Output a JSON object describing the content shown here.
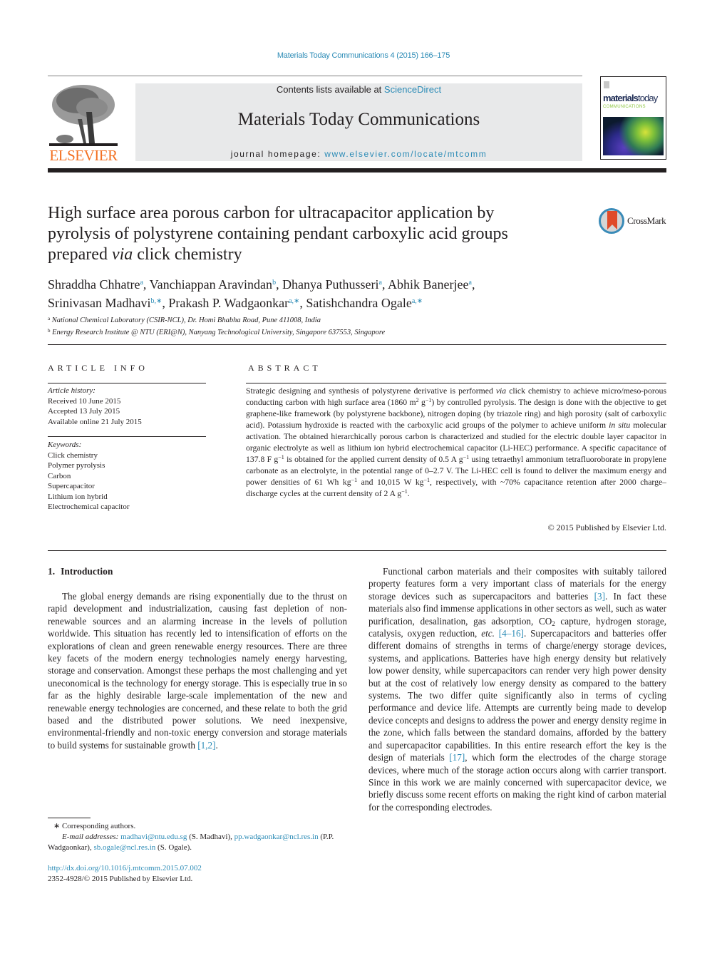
{
  "header": {
    "journal_ref": "Materials Today Communications 4 (2015) 166–175",
    "contents_prefix": "Contents lists available at ",
    "contents_link": "ScienceDirect",
    "journal_title": "Materials Today Communications",
    "homepage_prefix": "journal homepage: ",
    "homepage_link": "www.elsevier.com/locate/mtcomm",
    "publisher_logo_text": "ELSEVIER",
    "cover_brand_bold": "materials",
    "cover_brand_light": "today",
    "cover_sub": "COMMUNICATIONS",
    "crossmark_label": "CrossMark",
    "colors": {
      "link": "#2b8bb6",
      "elsevier_orange": "#f37021",
      "banner_bg": "#e8e9ea"
    }
  },
  "article": {
    "title_line1": "High surface area porous carbon for ultracapacitor application by",
    "title_line2": "pyrolysis of polystyrene containing pendant carboxylic acid groups",
    "title_line3_pre": "prepared ",
    "title_line3_it": "via",
    "title_line3_post": " click chemistry",
    "authors": [
      {
        "name": "Shraddha Chhatre",
        "aff": "a",
        "sep": ", "
      },
      {
        "name": "Vanchiappan Aravindan",
        "aff": "b",
        "sep": ", "
      },
      {
        "name": "Dhanya Puthusseri",
        "aff": "a",
        "sep": ", "
      },
      {
        "name": "Abhik Banerjee",
        "aff": "a",
        "sep": ","
      },
      {
        "name": "Srinivasan Madhavi",
        "aff": "b,∗",
        "sep": ", "
      },
      {
        "name": "Prakash P. Wadgaonkar",
        "aff": "a,∗",
        "sep": ", "
      },
      {
        "name": "Satishchandra Ogale",
        "aff": "a,∗",
        "sep": ""
      }
    ],
    "affiliations": [
      {
        "key": "a",
        "text": "National Chemical Laboratory (CSIR-NCL), Dr. Homi Bhabha Road, Pune 411008, India"
      },
      {
        "key": "b",
        "text": "Energy Research Institute @ NTU (ERI@N), Nanyang Technological University, Singapore 637553, Singapore"
      }
    ]
  },
  "article_info": {
    "heading": "ARTICLE INFO",
    "history_label": "Article history:",
    "history": [
      "Received 10 June 2015",
      "Accepted 13 July 2015",
      "Available online 21 July 2015"
    ],
    "keywords_label": "Keywords:",
    "keywords": [
      "Click chemistry",
      "Polymer pyrolysis",
      "Carbon",
      "Supercapacitor",
      "Lithium ion hybrid",
      "Electrochemical capacitor"
    ]
  },
  "abstract": {
    "heading": "ABSTRACT",
    "s1": "Strategic designing and synthesis of polystyrene derivative is performed ",
    "s1_it": "via",
    "s2": " click chemistry to achieve micro/meso-porous conducting carbon with high surface area (1860 m",
    "sup_2": "2",
    "s3": " g",
    "sup_m1": "−1",
    "s4": ") by controlled pyrolysis. The design is done with the objective to get graphene-like framework (by polystyrene backbone), nitrogen doping (by triazole ring) and high porosity (salt of carboxylic acid). Potassium hydroxide is reacted with the carboxylic acid groups of the polymer to achieve uniform ",
    "s4_it": "in situ",
    "s5": " molecular activation. The obtained hierarchically porous carbon is characterized and studied for the electric double layer capacitor in organic electrolyte as well as lithium ion hybrid electrochemical capacitor (Li-HEC) performance. A specific capacitance of 137.8 F g",
    "s6": " is obtained for the applied current density of 0.5 A g",
    "s7": " using tetraethyl ammonium tetrafluoroborate in propylene carbonate as an electrolyte, in the potential range of 0–2.7 V. The Li-HEC cell is found to deliver the maximum energy and power densities of 61 Wh kg",
    "s8": " and 10,015 W kg",
    "s9": ", respectively, with ~70% capacitance retention after 2000 charge–discharge cycles at the current density of 2 A g",
    "s10": ".",
    "copyright": "© 2015 Published by Elsevier Ltd."
  },
  "body": {
    "section_num": "1.",
    "section_title": "Introduction",
    "left_p1": "The global energy demands are rising exponentially due to the thrust on rapid development and industrialization, causing fast depletion of non-renewable sources and an alarming increase in the levels of pollution worldwide. This situation has recently led to intensification of efforts on the explorations of clean and green renewable energy resources. There are three key facets of the modern energy technologies namely energy harvesting, storage and conservation. Amongst these perhaps the most challenging and yet uneconomical is the technology for energy storage. This is especially true in so far as the highly desirable large-scale implementation of the new and renewable energy technologies are concerned, and these relate to both the grid based and the distributed power solutions. We need inexpensive, environmental-friendly and non-toxic energy conversion and storage materials to build systems for sustainable growth ",
    "left_ref": "[1,2]",
    "left_end": ".",
    "right_a": "Functional carbon materials and their composites with suitably tailored property features form a very important class of materials for the energy storage devices such as supercapacitors and batteries ",
    "right_ref1": "[3]",
    "right_b": ". In fact these materials also find immense applications in other sectors as well, such as water purification, desalination, gas adsorption, CO",
    "right_sub": "2",
    "right_c": " capture, hydrogen storage, catalysis, oxygen reduction, ",
    "right_etc": "etc.",
    "right_sp": " ",
    "right_ref2": "[4–16]",
    "right_d": ". Supercapacitors and batteries offer different domains of strengths in terms of charge/energy storage devices, systems, and applications. Batteries have high energy density but relatively low power density, while supercapacitors can render very high power density but at the cost of relatively low energy density as compared to the battery systems. The two differ quite significantly also in terms of cycling performance and device life. Attempts are currently being made to develop device concepts and designs to address the power and energy density regime in the zone, which falls between the standard domains, afforded by the battery and supercapacitor capabilities. In this entire research effort the key is the design of materials ",
    "right_ref3": "[17]",
    "right_e": ", which form the electrodes of the charge storage devices, where much of the storage action occurs along with carrier transport. Since in this work we are mainly concerned with supercapacitor device, we briefly discuss some recent efforts on making the right kind of carbon material for the corresponding electrodes."
  },
  "footnote": {
    "star": "∗ Corresponding authors.",
    "email_label": "E-mail addresses:",
    "email1": "madhavi@ntu.edu.sg",
    "email1_owner": " (S. Madhavi), ",
    "email2": "pp.wadgaonkar@ncl.res.in",
    "email2_owner": " (P.P. Wadgaonkar), ",
    "email3": "sb.ogale@ncl.res.in",
    "email3_owner": " (S. Ogale).",
    "doi": "http://dx.doi.org/10.1016/j.mtcomm.2015.07.002",
    "issn_line": "2352-4928/© 2015 Published by Elsevier Ltd."
  }
}
